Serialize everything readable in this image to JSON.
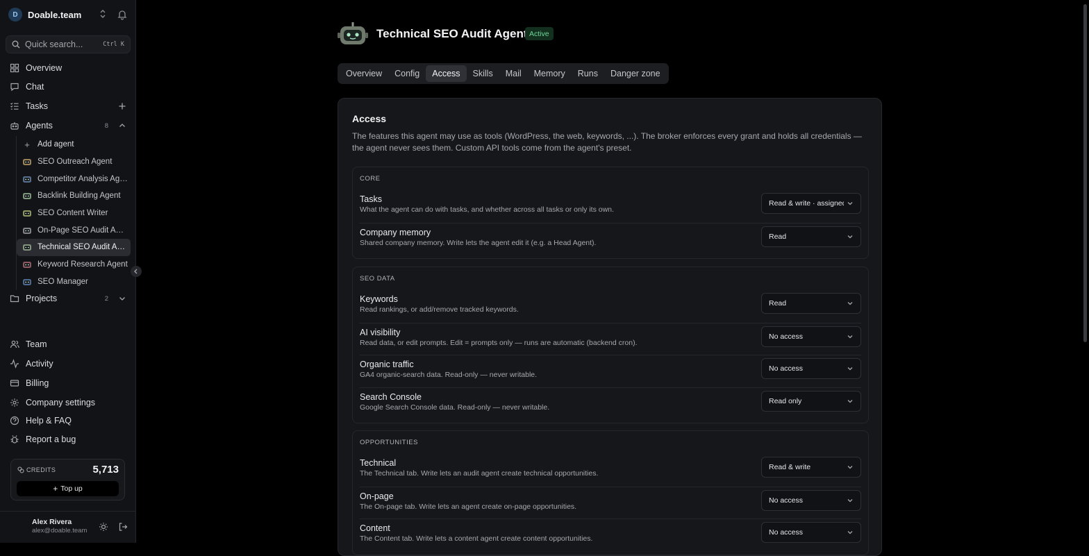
{
  "sidebar": {
    "workspace": {
      "initial": "D",
      "name": "Doable.team"
    },
    "search": {
      "placeholder": "Quick search...",
      "shortcut": "Ctrl K"
    },
    "nav": {
      "overview": "Overview",
      "chat": "Chat",
      "tasks": "Tasks",
      "agents": "Agents",
      "agents_count": "8",
      "add_agent": "Add agent",
      "projects": "Projects",
      "projects_count": "2",
      "team": "Team",
      "activity": "Activity",
      "billing": "Billing",
      "company_settings": "Company settings",
      "help": "Help & FAQ",
      "report_bug": "Report a bug"
    },
    "agents": [
      {
        "name": "SEO Outreach Agent",
        "color": "#c9a86a"
      },
      {
        "name": "Competitor Analysis Agent",
        "color": "#6e8fb8"
      },
      {
        "name": "Backlink Building Agent",
        "color": "#9fc49a"
      },
      {
        "name": "SEO Content Writer",
        "color": "#b8c37a"
      },
      {
        "name": "On-Page SEO Audit Agent",
        "color": "#a8a9ad"
      },
      {
        "name": "Technical SEO Audit Agent",
        "color": "#9fb89a"
      },
      {
        "name": "Keyword Research Agent",
        "color": "#b8707a"
      },
      {
        "name": "SEO Manager",
        "color": "#5f88b8"
      }
    ],
    "credits": {
      "label": "CREDITS",
      "value": "5,713",
      "topup": "Top up"
    },
    "user": {
      "name": "Alex Rivera",
      "email": "alex@doable.team"
    }
  },
  "header": {
    "title": "Technical SEO Audit Agent",
    "status": "Active",
    "status_color": "#6ed896",
    "tabs": [
      "Overview",
      "Config",
      "Access",
      "Skills",
      "Mail",
      "Memory",
      "Runs",
      "Danger zone"
    ],
    "active_tab": "Access"
  },
  "access": {
    "title": "Access",
    "description": "The features this agent may use as tools (WordPress, the web, keywords, ...). The broker enforces every grant and holds all credentials — the agent never sees them. Custom API tools come from the agent's preset.",
    "sections": [
      {
        "heading": "CORE",
        "rows": [
          {
            "title": "Tasks",
            "desc": "What the agent can do with tasks, and whether across all tasks or only its own.",
            "value": "Read & write · assigned"
          },
          {
            "title": "Company memory",
            "desc": "Shared company memory. Write lets the agent edit it (e.g. a Head Agent).",
            "value": "Read"
          }
        ]
      },
      {
        "heading": "SEO DATA",
        "rows": [
          {
            "title": "Keywords",
            "desc": "Read rankings, or add/remove tracked keywords.",
            "value": "Read"
          },
          {
            "title": "AI visibility",
            "desc": "Read data, or edit prompts. Edit = prompts only — runs are automatic (backend cron).",
            "value": "No access"
          },
          {
            "title": "Organic traffic",
            "desc": "GA4 organic-search data. Read-only — never writable.",
            "value": "No access"
          },
          {
            "title": "Search Console",
            "desc": "Google Search Console data. Read-only — never writable.",
            "value": "Read only"
          }
        ]
      },
      {
        "heading": "OPPORTUNITIES",
        "rows": [
          {
            "title": "Technical",
            "desc": "The Technical tab. Write lets an audit agent create technical opportunities.",
            "value": "Read & write"
          },
          {
            "title": "On-page",
            "desc": "The On-page tab. Write lets an agent create on-page opportunities.",
            "value": "No access"
          },
          {
            "title": "Content",
            "desc": "The Content tab. Write lets a content agent create content opportunities.",
            "value": "No access"
          }
        ]
      }
    ]
  }
}
